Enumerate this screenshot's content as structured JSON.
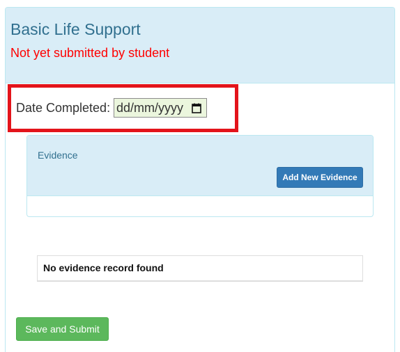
{
  "module": {
    "title": "Basic Life Support",
    "status": "Not yet submitted by student"
  },
  "date_field": {
    "label": "Date Completed:",
    "placeholder": "dd/mm/yyyy",
    "value": "",
    "icon": "calendar-icon"
  },
  "evidence": {
    "heading": "Evidence",
    "add_button": "Add New Evidence",
    "empty_message": "No evidence record found"
  },
  "actions": {
    "save_submit": "Save and Submit"
  },
  "colors": {
    "highlight": "#e3141b",
    "status": "#ff0000",
    "primary_button": "#337ab7",
    "success_button": "#5cb85c",
    "heading_bg": "#d9edf7",
    "date_input_bg": "#ebf6dd"
  }
}
